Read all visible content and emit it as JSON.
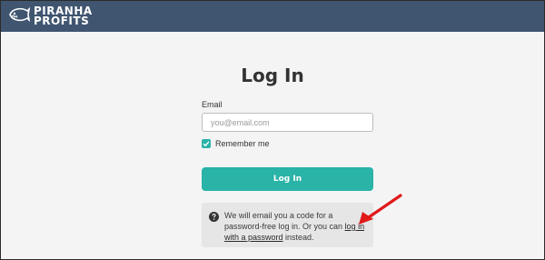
{
  "brand": {
    "logo_text": "PIRANHA\nPROFITS"
  },
  "login": {
    "title": "Log In",
    "email_label": "Email",
    "email_placeholder": "you@email.com",
    "email_value": "",
    "remember_label": "Remember me",
    "remember_checked": true,
    "submit_label": "Log In"
  },
  "info": {
    "text_before": "We will email you a code for a password-free log in. Or you can ",
    "link_text": "log in with a password",
    "text_after": " instead."
  },
  "colors": {
    "header": "#3f5570",
    "accent": "#2ab3a7",
    "annotation_arrow": "#e11919"
  },
  "icons": [
    "piranha-fish-icon",
    "checkmark-icon",
    "question-circle-icon",
    "red-arrow-icon"
  ]
}
